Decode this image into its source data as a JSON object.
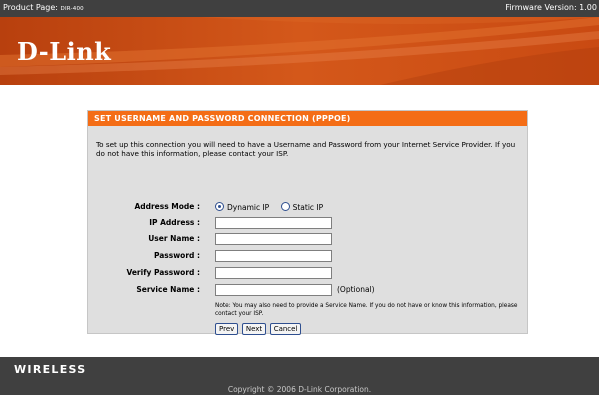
{
  "header": {
    "product_label": "Product Page: ",
    "product_model": "DIR-400",
    "firmware": "Firmware Version: 1.00"
  },
  "banner": {
    "logo_text": "D-Link"
  },
  "panel": {
    "title": "SET USERNAME AND PASSWORD CONNECTION (PPPOE)",
    "description": "To set up this connection you will need to have a Username and Password from your Internet Service Provider. If you do not have this information, please contact your ISP.",
    "fields": {
      "address_mode_label": "Address Mode :",
      "dynamic_ip_label": "Dynamic IP",
      "static_ip_label": "Static IP",
      "selected_mode": "Dynamic IP",
      "ip_address_label": "IP Address :",
      "ip_address_value": "",
      "user_name_label": "User Name :",
      "user_name_value": "",
      "password_label": "Password :",
      "password_value": "",
      "verify_password_label": "Verify Password :",
      "verify_password_value": "",
      "service_name_label": "Service Name :",
      "service_name_value": "",
      "optional_text": "(Optional)"
    },
    "note": "Note: You may also need to provide a Service Name. If you do not have or know this information, please contact your ISP.",
    "buttons": {
      "prev": "Prev",
      "next": "Next",
      "cancel": "Cancel"
    }
  },
  "footer": {
    "brand": "WIRELESS",
    "copyright": "Copyright © 2006 D-Link Corporation."
  },
  "colors": {
    "topbar": "#404040",
    "banner": "#c94a12",
    "panel_header": "#f46d16",
    "panel_bg": "#dfdfdf",
    "footer": "#404040"
  }
}
